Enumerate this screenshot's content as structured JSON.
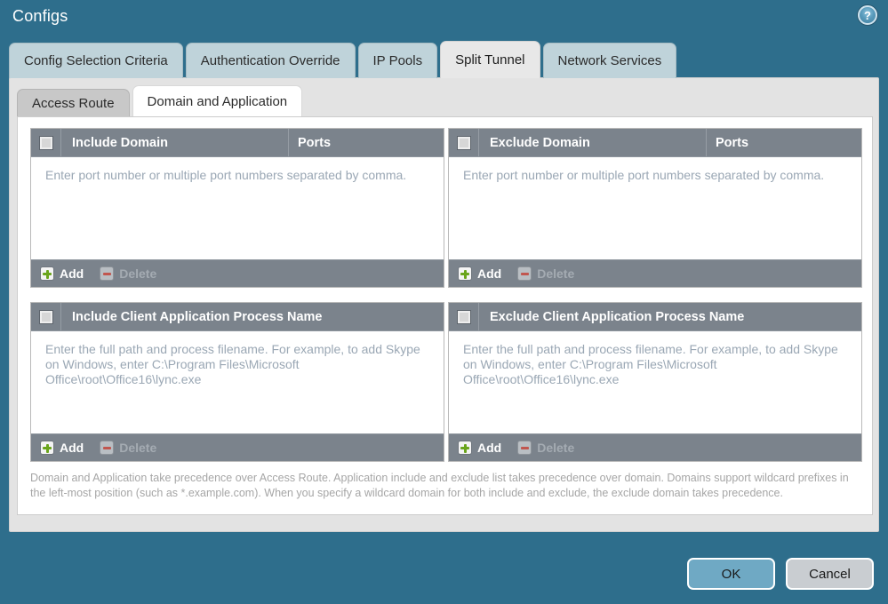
{
  "window": {
    "title": "Configs",
    "help_icon": "help-circle-icon",
    "accent_color": "#2e6e8c"
  },
  "tabs": [
    {
      "label": "Config Selection Criteria",
      "active": false
    },
    {
      "label": "Authentication Override",
      "active": false
    },
    {
      "label": "IP Pools",
      "active": false
    },
    {
      "label": "Split Tunnel",
      "active": true
    },
    {
      "label": "Network Services",
      "active": false
    }
  ],
  "subtabs": [
    {
      "label": "Access Route",
      "active": false
    },
    {
      "label": "Domain and Application",
      "active": true
    }
  ],
  "grids": [
    {
      "id": "include-domain",
      "header": "Include Domain",
      "ports_header": "Ports",
      "checkbox": "select-all-checkbox",
      "hint": "Enter port number or multiple port numbers separated by comma.",
      "add_label": "Add",
      "delete_label": "Delete",
      "add_icon": "plus-square-icon",
      "delete_icon": "minus-square-icon",
      "delete_disabled": true
    },
    {
      "id": "exclude-domain",
      "header": "Exclude Domain",
      "ports_header": "Ports",
      "checkbox": "select-all-checkbox",
      "hint": "Enter port number or multiple port numbers separated by comma.",
      "add_label": "Add",
      "delete_label": "Delete",
      "add_icon": "plus-square-icon",
      "delete_icon": "minus-square-icon",
      "delete_disabled": true
    },
    {
      "id": "include-process",
      "header": "Include Client Application Process Name",
      "checkbox": "select-all-checkbox",
      "hint": "Enter the full path and process filename. For example, to add Skype on Windows, enter C:\\Program Files\\Microsoft Office\\root\\Office16\\lync.exe",
      "add_label": "Add",
      "delete_label": "Delete",
      "add_icon": "plus-square-icon",
      "delete_icon": "minus-square-icon",
      "delete_disabled": true
    },
    {
      "id": "exclude-process",
      "header": "Exclude Client Application Process Name",
      "checkbox": "select-all-checkbox",
      "hint": "Enter the full path and process filename. For example, to add Skype on Windows, enter C:\\Program Files\\Microsoft Office\\root\\Office16\\lync.exe",
      "add_label": "Add",
      "delete_label": "Delete",
      "add_icon": "plus-square-icon",
      "delete_icon": "minus-square-icon",
      "delete_disabled": true
    }
  ],
  "note": "Domain and Application take precedence over Access Route. Application include and exclude list takes precedence over domain. Domains support wildcard prefixes in the left-most position (such as *.example.com). When you specify a wildcard domain for both include and exclude, the exclude domain takes precedence.",
  "dialog_buttons": {
    "ok": "OK",
    "cancel": "Cancel"
  }
}
